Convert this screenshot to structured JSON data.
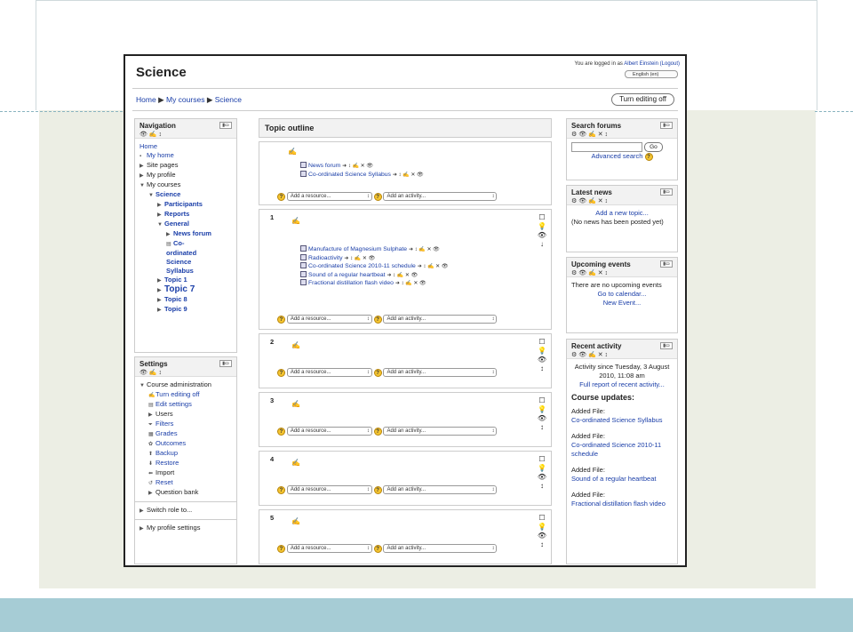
{
  "site_title": "Science",
  "login": {
    "prefix": "You are logged in as",
    "user": "Albert Einstein",
    "logout": "(Logout)"
  },
  "language": "English (en)",
  "breadcrumb": {
    "home": "Home",
    "sep": "▶",
    "my_courses": "My courses",
    "current": "Science"
  },
  "turn_editing_button": "Turn editing off",
  "navigation": {
    "title": "Navigation",
    "items": [
      {
        "label": "Home"
      },
      {
        "label": "My home"
      },
      {
        "label": "Site pages"
      },
      {
        "label": "My profile"
      },
      {
        "label": "My courses"
      },
      {
        "label": "Science"
      },
      {
        "label": "Participants"
      },
      {
        "label": "Reports"
      },
      {
        "label": "General"
      },
      {
        "label": "News forum"
      },
      {
        "label": "Co-ordinated Science Syllabus"
      },
      {
        "label": "Topic 1"
      },
      {
        "label": "Topic 7"
      },
      {
        "label": "Topic 8"
      },
      {
        "label": "Topic 9"
      }
    ]
  },
  "settings": {
    "title": "Settings",
    "course_admin": "Course administration",
    "items": [
      "Turn editing off",
      "Edit settings",
      "Users",
      "Filters",
      "Grades",
      "Outcomes",
      "Backup",
      "Restore",
      "Import",
      "Reset",
      "Question bank"
    ],
    "switch_role": "Switch role to...",
    "profile_settings": "My profile settings"
  },
  "topics": {
    "header": "Topic outline",
    "add_resource": "Add a resource...",
    "add_activity": "Add an activity...",
    "section0": [
      "News forum",
      "Co-ordinated Science Syllabus"
    ],
    "section1": [
      "Manufacture of Magnesium Sulphate",
      "Radioactivity",
      "Co-ordinated Science 2010-11 schedule",
      "Sound of a regular heartbeat",
      "Fractional distillation flash video"
    ],
    "numbers": [
      "1",
      "2",
      "3",
      "4",
      "5"
    ]
  },
  "search_forums": {
    "title": "Search forums",
    "go": "Go",
    "advanced": "Advanced search"
  },
  "latest_news": {
    "title": "Latest news",
    "add_topic": "Add a new topic...",
    "empty": "(No news has been posted yet)"
  },
  "upcoming_events": {
    "title": "Upcoming events",
    "empty": "There are no upcoming events",
    "calendar": "Go to calendar...",
    "new_event": "New Event..."
  },
  "recent_activity": {
    "title": "Recent activity",
    "since": "Activity since Tuesday, 3 August 2010, 11:08 am",
    "full_report": "Full report of recent activity...",
    "updates_title": "Course updates:",
    "added_label": "Added File:",
    "files": [
      "Co-ordinated Science Syllabus",
      "Co-ordinated Science 2010-11 schedule",
      "Sound of a regular heartbeat",
      "Fractional distillation flash video"
    ]
  },
  "icons": {
    "edit": "✍",
    "move": "➜",
    "hide": "👁",
    "delete": "✕",
    "help": "?"
  }
}
